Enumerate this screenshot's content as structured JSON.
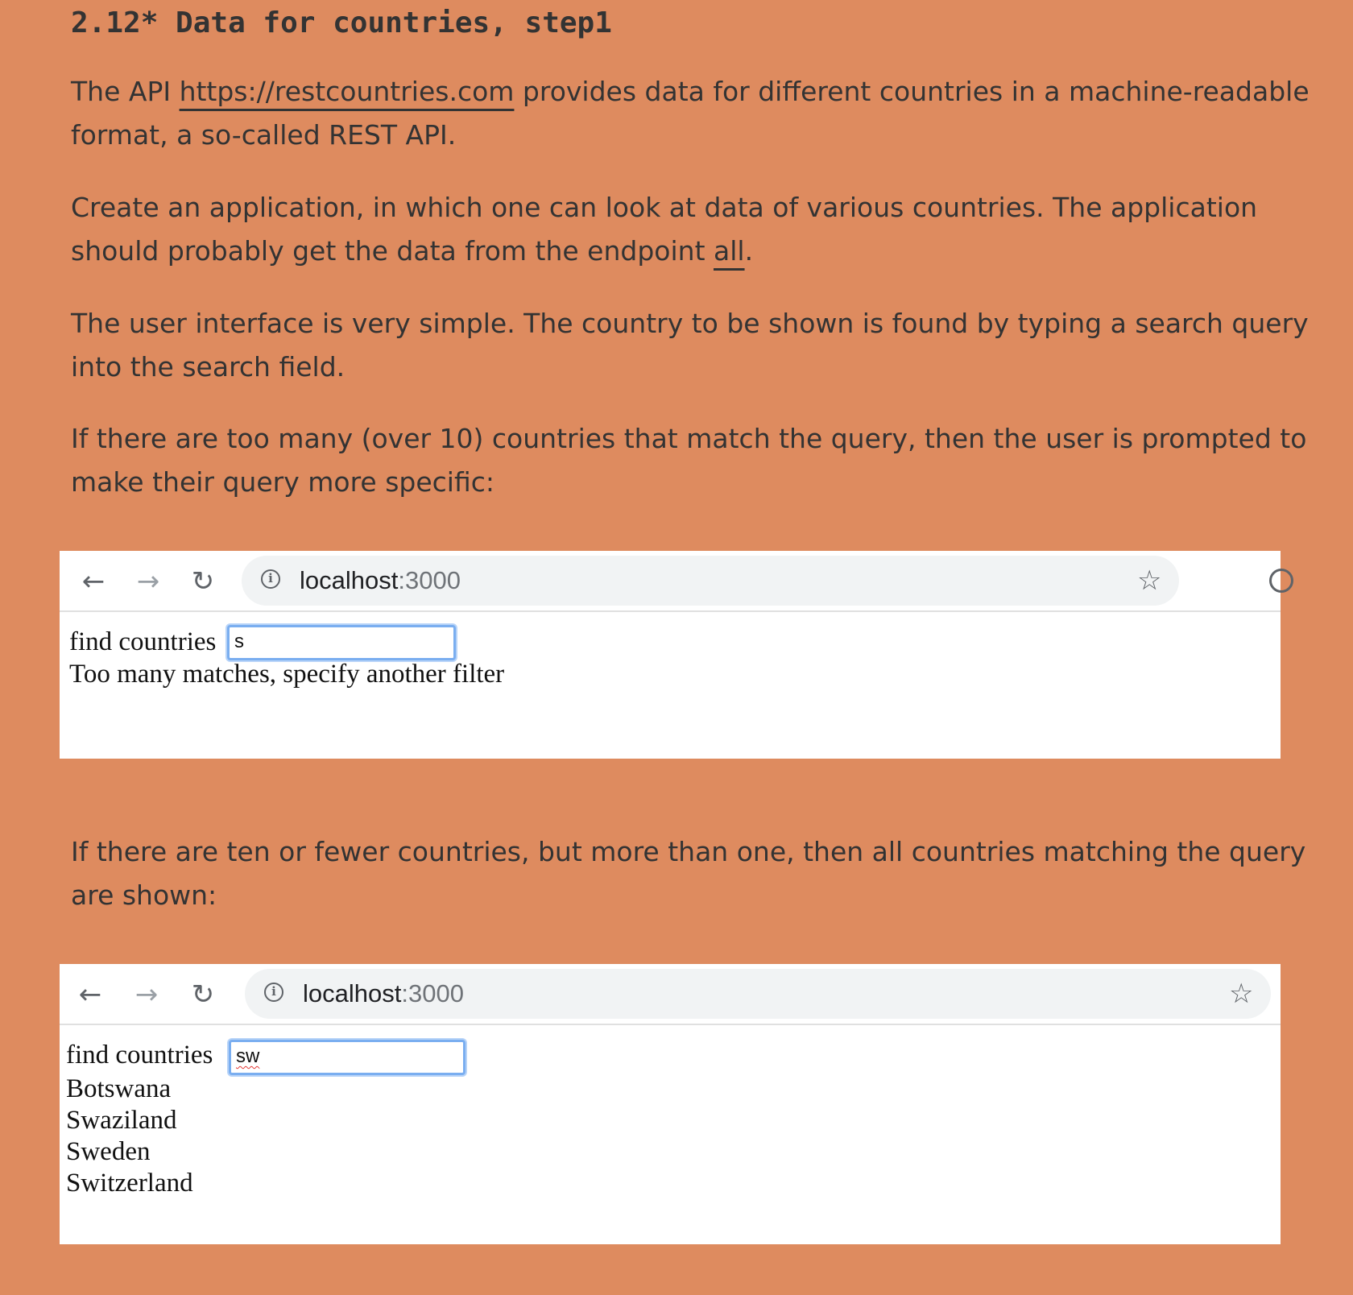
{
  "heading": "2.12* Data for countries, step1",
  "paragraphs": {
    "p1_a": "The API ",
    "p1_link": "https://restcountries.com",
    "p1_b": " provides data for different countries in a machine-readable format, a so-called REST API.",
    "p2_a": "Create an application, in which one can look at data of various countries. The application should probably get the data from the endpoint ",
    "p2_link": "all",
    "p2_b": ".",
    "p3": "The user interface is very simple. The country to be shown is found by typing a search query into the search field.",
    "p4": "If there are too many (over 10) countries that match the query, then the user is prompted to make their query more specific:",
    "p5": "If there are ten or fewer countries, but more than one, then all countries matching the query are shown:"
  },
  "screenshot1": {
    "url_host": "localhost",
    "url_port": ":3000",
    "label": "find countries",
    "query": "s",
    "message": "Too many matches, specify another filter"
  },
  "screenshot2": {
    "url_host": "localhost",
    "url_port": ":3000",
    "label": "find countries",
    "query": "sw",
    "results": [
      "Botswana",
      "Swaziland",
      "Sweden",
      "Switzerland"
    ]
  },
  "icons": {
    "back": "back-arrow-icon",
    "forward": "forward-arrow-icon",
    "reload": "reload-icon",
    "info": "info-icon",
    "bookmark": "star-icon"
  },
  "colors": {
    "page_background": "#de8b5f",
    "text": "#333333",
    "focus_ring": "#7aaef0"
  }
}
